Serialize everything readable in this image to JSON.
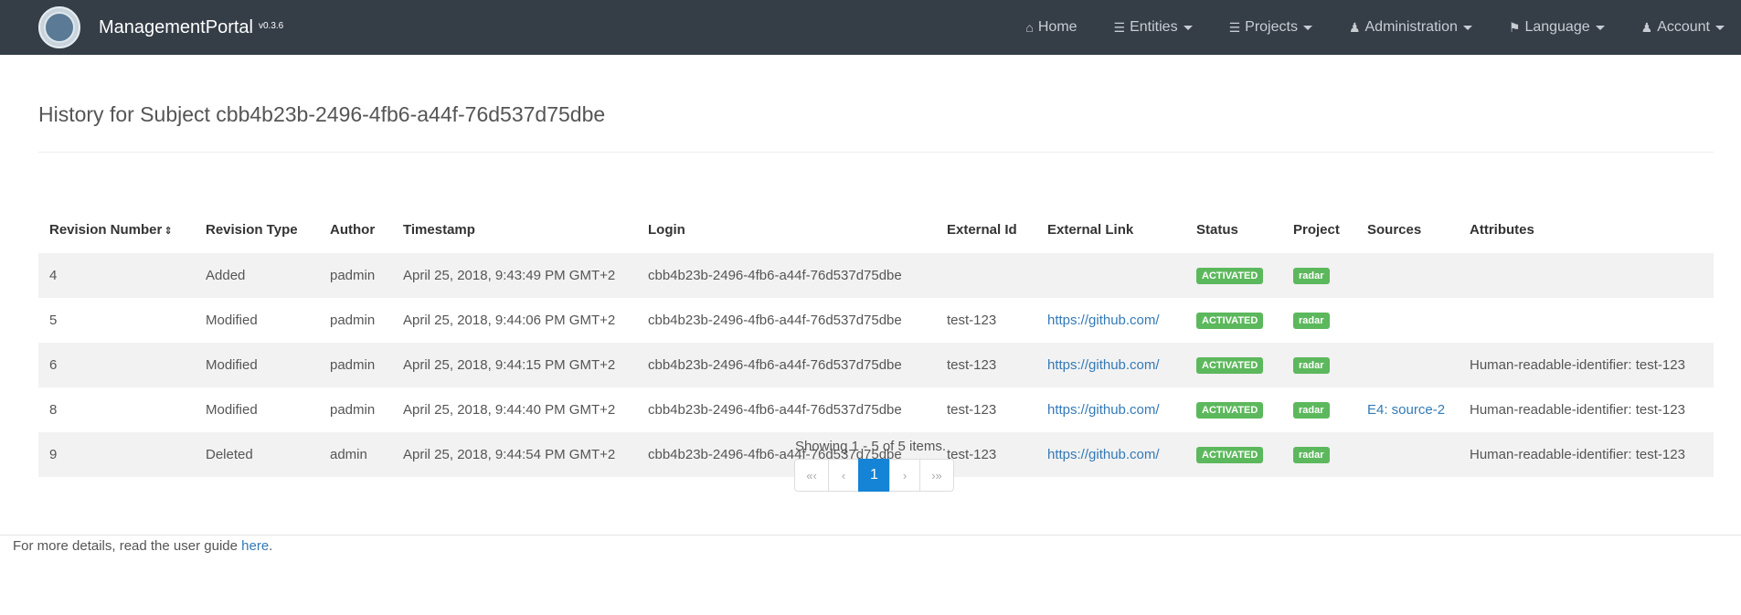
{
  "navbar": {
    "brand": "ManagementPortal",
    "version": "v0.3.6",
    "items": [
      {
        "label": "Home",
        "icon": "home-icon",
        "dropdown": false
      },
      {
        "label": "Entities",
        "icon": "list-icon",
        "dropdown": true
      },
      {
        "label": "Projects",
        "icon": "list-icon",
        "dropdown": true
      },
      {
        "label": "Administration",
        "icon": "user-plus-icon",
        "dropdown": true
      },
      {
        "label": "Language",
        "icon": "flag-icon",
        "dropdown": true
      },
      {
        "label": "Account",
        "icon": "user-icon",
        "dropdown": true
      }
    ]
  },
  "page": {
    "title": "History for Subject cbb4b23b-2496-4fb6-a44f-76d537d75dbe"
  },
  "table": {
    "headers": [
      "Revision Number",
      "Revision Type",
      "Author",
      "Timestamp",
      "Login",
      "External Id",
      "External Link",
      "Status",
      "Project",
      "Sources",
      "Attributes"
    ],
    "rows": [
      {
        "revision": "4",
        "type": "Added",
        "author": "padmin",
        "timestamp": "April 25, 2018, 9:43:49 PM GMT+2",
        "login": "cbb4b23b-2496-4fb6-a44f-76d537d75dbe",
        "external_id": "",
        "external_link": "",
        "status": "ACTIVATED",
        "project": "radar",
        "sources": "",
        "attributes": ""
      },
      {
        "revision": "5",
        "type": "Modified",
        "author": "padmin",
        "timestamp": "April 25, 2018, 9:44:06 PM GMT+2",
        "login": "cbb4b23b-2496-4fb6-a44f-76d537d75dbe",
        "external_id": "test-123",
        "external_link": "https://github.com/",
        "status": "ACTIVATED",
        "project": "radar",
        "sources": "",
        "attributes": ""
      },
      {
        "revision": "6",
        "type": "Modified",
        "author": "padmin",
        "timestamp": "April 25, 2018, 9:44:15 PM GMT+2",
        "login": "cbb4b23b-2496-4fb6-a44f-76d537d75dbe",
        "external_id": "test-123",
        "external_link": "https://github.com/",
        "status": "ACTIVATED",
        "project": "radar",
        "sources": "",
        "attributes": "Human-readable-identifier: test-123"
      },
      {
        "revision": "8",
        "type": "Modified",
        "author": "padmin",
        "timestamp": "April 25, 2018, 9:44:40 PM GMT+2",
        "login": "cbb4b23b-2496-4fb6-a44f-76d537d75dbe",
        "external_id": "test-123",
        "external_link": "https://github.com/",
        "status": "ACTIVATED",
        "project": "radar",
        "sources": "E4: source-2",
        "attributes": "Human-readable-identifier: test-123"
      },
      {
        "revision": "9",
        "type": "Deleted",
        "author": "admin",
        "timestamp": "April 25, 2018, 9:44:54 PM GMT+2",
        "login": "cbb4b23b-2496-4fb6-a44f-76d537d75dbe",
        "external_id": "test-123",
        "external_link": "https://github.com/",
        "status": "ACTIVATED",
        "project": "radar",
        "sources": "",
        "attributes": "Human-readable-identifier: test-123"
      }
    ]
  },
  "pagination": {
    "info": "Showing 1 - 5 of 5 items.",
    "first": "«‹",
    "prev": "‹",
    "current": "1",
    "next": "›",
    "last": "›»"
  },
  "footer": {
    "text": "For more details, read the user guide ",
    "link": "here",
    "suffix": "."
  },
  "colors": {
    "navbar": "#353d47",
    "status_badge": "#5cb85c",
    "active_page": "#1584d6",
    "link": "#337ab7"
  }
}
